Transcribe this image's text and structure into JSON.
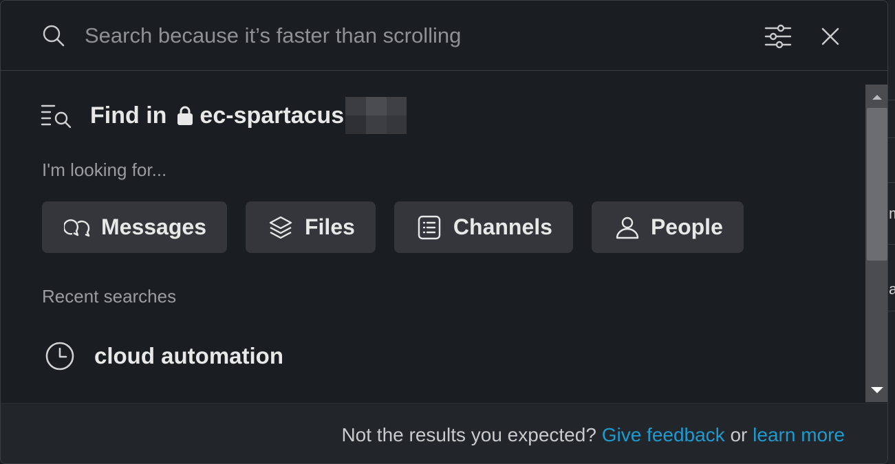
{
  "search": {
    "placeholder": "Search because it’s faster than scrolling",
    "value": ""
  },
  "find_in": {
    "prefix": "Find in",
    "channel": "ec-spartacus"
  },
  "looking_for_label": "I'm looking for...",
  "filters": [
    {
      "label": "Messages",
      "icon": "messages-icon"
    },
    {
      "label": "Files",
      "icon": "files-icon"
    },
    {
      "label": "Channels",
      "icon": "channels-icon"
    },
    {
      "label": "People",
      "icon": "people-icon"
    }
  ],
  "recent": {
    "heading": "Recent searches",
    "items": [
      {
        "label": "cloud automation",
        "icon": "clock-icon"
      }
    ]
  },
  "footer": {
    "text": "Not the results you expected?",
    "feedback_link": "Give feedback",
    "or": "or",
    "learn_link": "learn more"
  },
  "colors": {
    "background": "#1a1d21",
    "chip": "#34363b",
    "link": "#1d9bd1",
    "footer": "#222529"
  }
}
